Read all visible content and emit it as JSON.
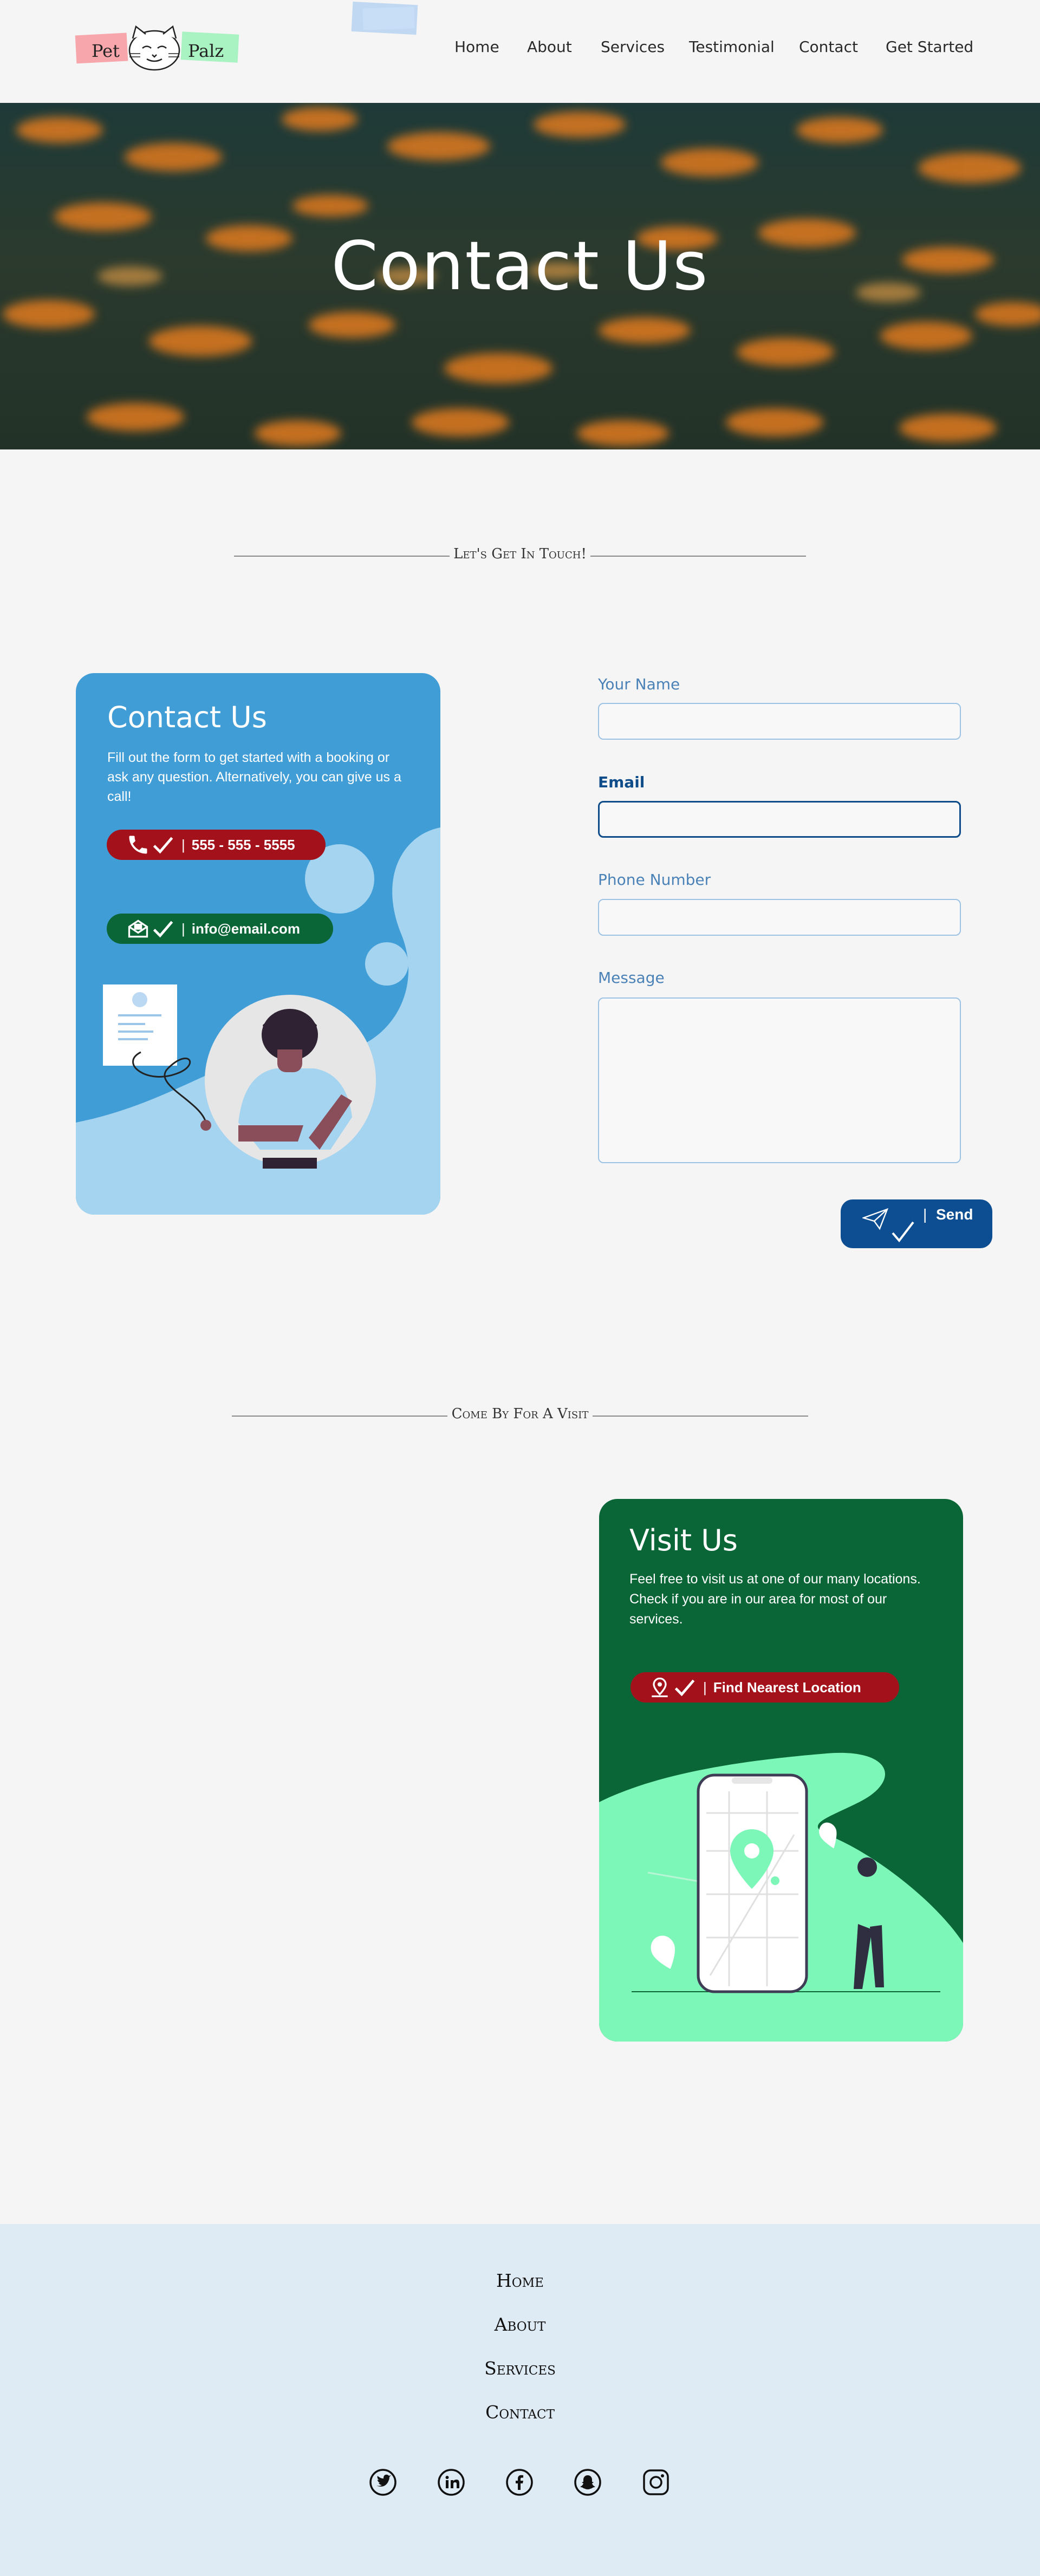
{
  "header": {
    "logo": {
      "word1": "Pet",
      "word2": "Palz"
    },
    "nav": [
      "Home",
      "About",
      "Services",
      "Testimonial",
      "Contact",
      "Get Started"
    ]
  },
  "hero": {
    "title": "Contact Us"
  },
  "get_in_touch": {
    "title": "Let's Get In Touch!"
  },
  "contact_card": {
    "title": "Contact Us",
    "text": "Fill out the form to get started with a booking or ask any question. Alternatively, you can give us a call!",
    "phone": "555 - 555 - 5555",
    "email": "info@email.com",
    "separator": "|"
  },
  "form": {
    "name_label": "Your Name",
    "email_label": "Email",
    "phone_label": "Phone Number",
    "message_label": "Message",
    "send_label": "Send",
    "send_separator": "|"
  },
  "visit_section": {
    "title": "Come By For A Visit"
  },
  "visit_card": {
    "title": "Visit Us",
    "text": "Feel free to visit us at one of our many locations. Check if you are in our area for most of our services.",
    "button_label": "Find Nearest Location",
    "separator": "|"
  },
  "footer": {
    "links": [
      "Home",
      "About",
      "Services",
      "Contact"
    ],
    "social_icons": [
      "twitter-icon",
      "linkedin-icon",
      "facebook-icon",
      "snapchat-icon",
      "instagram-icon"
    ]
  },
  "colors": {
    "contact_card": "#419dd6",
    "phone_pill": "#a3111b",
    "email_pill": "#0b6637",
    "visit_card": "#0b6637",
    "visit_accent": "#7cf7b7",
    "send_button": "#0d4e92",
    "footer_bg": "#deeaf4"
  }
}
